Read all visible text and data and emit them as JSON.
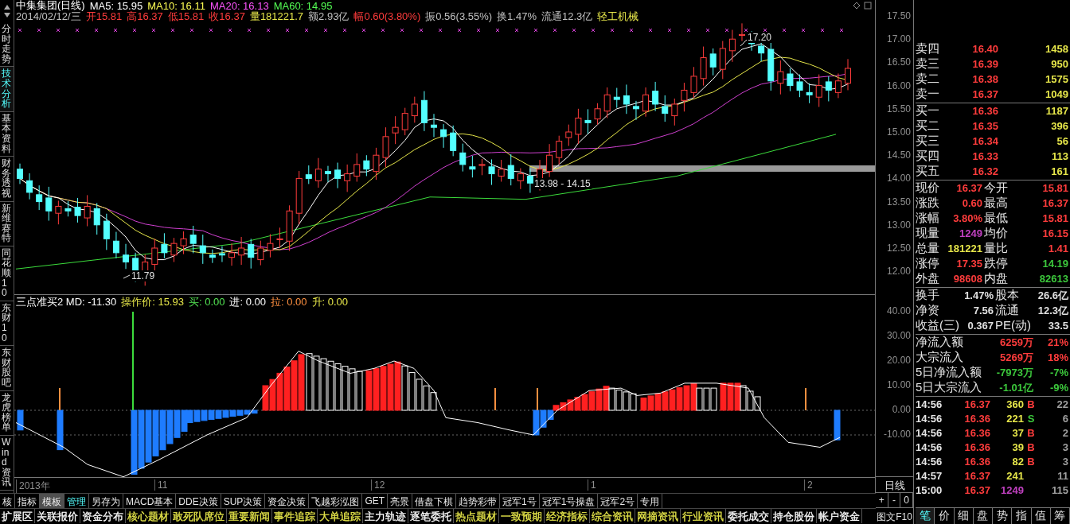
{
  "header": {
    "title_items": [
      {
        "text": "中集集团(日线)",
        "color": "#ffffff"
      },
      {
        "text": "MA5: 15.95",
        "color": "#ffffff"
      },
      {
        "text": "MA10: 16.11",
        "color": "#ffff54"
      },
      {
        "text": "MA20: 16.13",
        "color": "#ff54ff"
      },
      {
        "text": "MA60: 14.95",
        "color": "#54ff54"
      }
    ],
    "quote_items": [
      {
        "text": "2014/02/12/三",
        "color": "#c0c0c0"
      },
      {
        "text": "开15.81",
        "color": "#ff3c3c"
      },
      {
        "text": "高16.37",
        "color": "#ff3c3c"
      },
      {
        "text": "低15.81",
        "color": "#ff3c3c"
      },
      {
        "text": "收16.37",
        "color": "#ff3c3c"
      },
      {
        "text": "量181221.7",
        "color": "#e6e64a"
      },
      {
        "text": "额2.93亿",
        "color": "#c0c0c0"
      },
      {
        "text": "幅0.60(3.80%)",
        "color": "#ff3c3c"
      },
      {
        "text": "振0.56(3.55%)",
        "color": "#c0c0c0"
      },
      {
        "text": "换1.47%",
        "color": "#c0c0c0"
      },
      {
        "text": "流通12.3亿",
        "color": "#c0c0c0"
      },
      {
        "text": "轻工机械",
        "color": "#e6e64a"
      }
    ]
  },
  "left_tabs": [
    {
      "label": "分时走势",
      "selected": false
    },
    {
      "label": "技术分析",
      "selected": true
    },
    {
      "label": "基本资料",
      "selected": false
    },
    {
      "label": "财务透视",
      "selected": false
    },
    {
      "label": "新维赛特",
      "selected": false
    },
    {
      "label": "同花顺10",
      "selected": false
    },
    {
      "label": "东财10",
      "selected": false
    },
    {
      "label": "东财股吧",
      "selected": false
    },
    {
      "label": "龙虎榜单",
      "selected": false
    },
    {
      "label": "Wind资讯",
      "selected": false
    }
  ],
  "price_axis": [
    "17.50",
    "17.00",
    "16.50",
    "16.00",
    "15.50",
    "15.00",
    "14.50",
    "14.00",
    "13.50",
    "13.00",
    "12.50",
    "12.00"
  ],
  "annotations": [
    "17.20",
    "13.98 - 14.15",
    "11.79"
  ],
  "indicator": {
    "items": [
      {
        "text": "三点准买2 MD: -11.30",
        "color": "#ffffff"
      },
      {
        "text": "操作价: 15.93",
        "color": "#e6e64a"
      },
      {
        "text": "买: 0.00",
        "color": "#54e654"
      },
      {
        "text": "进: 0.00",
        "color": "#ffffff"
      },
      {
        "text": "拉: 0.00",
        "color": "#ff9040"
      },
      {
        "text": "升: 0.00",
        "color": "#e6e64a"
      }
    ]
  },
  "indicator_axis": [
    "40.00",
    "30.00",
    "20.00",
    "10.00",
    "0.00",
    "-10.00"
  ],
  "date_axis": [
    "2013年",
    "11",
    "12",
    "1",
    "2"
  ],
  "toolbar": [
    {
      "label": "核",
      "selected": false,
      "pressed": false
    },
    {
      "label": "指标",
      "selected": false,
      "pressed": false
    },
    {
      "label": "模板",
      "selected": false,
      "pressed": true
    },
    {
      "label": "管理",
      "selected": true,
      "pressed": false
    },
    {
      "label": "另存为",
      "selected": false,
      "pressed": false
    },
    {
      "label": "MACD基本",
      "selected": false,
      "pressed": false
    },
    {
      "label": "DDE决策",
      "selected": false,
      "pressed": false
    },
    {
      "label": "SUP决策",
      "selected": false,
      "pressed": false
    },
    {
      "label": "资金决策",
      "selected": false,
      "pressed": false
    },
    {
      "label": "飞越彩泓图",
      "selected": false,
      "pressed": false
    },
    {
      "label": "GET",
      "selected": false,
      "pressed": false
    },
    {
      "label": "亮景",
      "selected": false,
      "pressed": false
    },
    {
      "label": "借盘下棋",
      "selected": false,
      "pressed": false
    },
    {
      "label": "趋势彩带",
      "selected": false,
      "pressed": false
    },
    {
      "label": "冠军1号",
      "selected": false,
      "pressed": false
    },
    {
      "label": "冠军1号操盘",
      "selected": false,
      "pressed": false
    },
    {
      "label": "冠军2号",
      "selected": false,
      "pressed": false
    },
    {
      "label": "专用",
      "selected": false,
      "pressed": false
    }
  ],
  "feature_bar": [
    {
      "label": "扩展区",
      "color": "#ffffff"
    },
    {
      "label": "关联报价",
      "color": "#ffffff"
    },
    {
      "label": "资金分布",
      "color": "#ffffff"
    },
    {
      "label": "核心题材",
      "color": "#e6e64a"
    },
    {
      "label": "敢死队席位",
      "color": "#e6e64a"
    },
    {
      "label": "重要新闻",
      "color": "#e6e64a"
    },
    {
      "label": "事件追踪",
      "color": "#e6e64a"
    },
    {
      "label": "大单追踪",
      "color": "#e6e64a"
    },
    {
      "label": "主力轨迹",
      "color": "#ffffff"
    },
    {
      "label": "逐笔委托",
      "color": "#ffffff"
    },
    {
      "label": "热点题材",
      "color": "#e6e64a"
    },
    {
      "label": "一致预期",
      "color": "#e6e64a"
    },
    {
      "label": "经济指标",
      "color": "#e6e64a"
    },
    {
      "label": "综合资讯",
      "color": "#e6e64a"
    },
    {
      "label": "网摘资讯",
      "color": "#e6e64a"
    },
    {
      "label": "行业资讯",
      "color": "#e6e64a"
    },
    {
      "label": "委托成交",
      "color": "#ffffff"
    },
    {
      "label": "持仓股份",
      "color": "#ffffff"
    },
    {
      "label": "帐户资金",
      "color": "#ffffff"
    }
  ],
  "period": "日线",
  "zoom_buttons": [
    "+",
    "-",
    "0"
  ],
  "f10_button": "图文F10",
  "order_book": {
    "asks": [
      {
        "label": "卖四",
        "price": "16.40",
        "volume": "1458"
      },
      {
        "label": "卖三",
        "price": "16.39",
        "volume": "950"
      },
      {
        "label": "卖二",
        "price": "16.38",
        "volume": "1575"
      },
      {
        "label": "卖一",
        "price": "16.37",
        "volume": "1049"
      }
    ],
    "bids": [
      {
        "label": "买一",
        "price": "16.36",
        "volume": "1187"
      },
      {
        "label": "买二",
        "price": "16.35",
        "volume": "396"
      },
      {
        "label": "买三",
        "price": "16.34",
        "volume": "56"
      },
      {
        "label": "买四",
        "price": "16.33",
        "volume": "113"
      },
      {
        "label": "买五",
        "price": "16.32",
        "volume": "161"
      }
    ]
  },
  "stats": [
    {
      "label": "现价",
      "value": "16.37",
      "color": "#ff3c3c"
    },
    {
      "label": "今开",
      "value": "15.81",
      "color": "#ff3c3c"
    },
    {
      "label": "涨跌",
      "value": "0.60",
      "color": "#ff3c3c"
    },
    {
      "label": "最高",
      "value": "16.37",
      "color": "#ff3c3c"
    },
    {
      "label": "涨幅",
      "value": "3.80%",
      "color": "#ff3c3c"
    },
    {
      "label": "最低",
      "value": "15.81",
      "color": "#ff3c3c"
    },
    {
      "label": "现量",
      "value": "1249",
      "color": "#c040c0"
    },
    {
      "label": "均价",
      "value": "16.15",
      "color": "#ff3c3c"
    },
    {
      "label": "总量",
      "value": "181221",
      "color": "#e6e64a"
    },
    {
      "label": "量比",
      "value": "1.41",
      "color": "#ff3c3c"
    },
    {
      "label": "涨停",
      "value": "17.35",
      "color": "#ff3c3c"
    },
    {
      "label": "跌停",
      "value": "14.19",
      "color": "#3cc83c"
    },
    {
      "label": "外盘",
      "value": "98608",
      "color": "#ff3c3c"
    },
    {
      "label": "内盘",
      "value": "82613",
      "color": "#3cc83c"
    }
  ],
  "fundamentals": [
    {
      "label": "换手",
      "value": "1.47%"
    },
    {
      "label": "股本",
      "value": "26.6亿"
    },
    {
      "label": "净资",
      "value": "7.56"
    },
    {
      "label": "流通",
      "value": "12.3亿"
    },
    {
      "label": "收益(三)",
      "value": "0.367"
    },
    {
      "label": "PE(动)",
      "value": "33.5"
    }
  ],
  "flows": [
    {
      "label": "净流入额",
      "amount": "6259万",
      "percent": "21%",
      "color": "#ff3c3c"
    },
    {
      "label": "大宗流入",
      "amount": "5269万",
      "percent": "18%",
      "color": "#ff3c3c"
    },
    {
      "label": "5日净流入额",
      "amount": "-7973万",
      "percent": "-7%",
      "color": "#3cc83c"
    },
    {
      "label": "5日大宗流入",
      "amount": "-1.01亿",
      "percent": "-9%",
      "color": "#3cc83c"
    }
  ],
  "ticks": [
    {
      "time": "14:56",
      "price": "16.37",
      "volume": {
        "text": "360",
        "color": "#e6e64a"
      },
      "side": {
        "text": "B",
        "color": "#ff3c3c"
      },
      "count": "22"
    },
    {
      "time": "14:56",
      "price": "16.36",
      "volume": {
        "text": "221",
        "color": "#e6e64a"
      },
      "side": {
        "text": "S",
        "color": "#3cc83c"
      },
      "count": "6"
    },
    {
      "time": "14:56",
      "price": "16.36",
      "volume": {
        "text": "37",
        "color": "#e6e64a"
      },
      "side": {
        "text": "B",
        "color": "#ff3c3c"
      },
      "count": "2"
    },
    {
      "time": "14:56",
      "price": "16.36",
      "volume": {
        "text": "39",
        "color": "#e6e64a"
      },
      "side": {
        "text": "B",
        "color": "#ff3c3c"
      },
      "count": "3"
    },
    {
      "time": "14:56",
      "price": "16.36",
      "volume": {
        "text": "82",
        "color": "#e6e64a"
      },
      "side": {
        "text": "B",
        "color": "#ff3c3c"
      },
      "count": "3"
    },
    {
      "time": "14:57",
      "price": "16.37",
      "volume": {
        "text": "241",
        "color": "#e6e64a"
      },
      "count": "11"
    },
    {
      "time": "15:00",
      "price": "16.37",
      "volume": {
        "text": "1249",
        "color": "#c040c0"
      },
      "count": "115"
    }
  ],
  "detail_tabs": [
    {
      "label": "笔",
      "selected": true
    },
    {
      "label": "价",
      "selected": false
    },
    {
      "label": "细",
      "selected": false
    },
    {
      "label": "盘",
      "selected": false
    },
    {
      "label": "势",
      "selected": false
    },
    {
      "label": "指",
      "selected": false
    },
    {
      "label": "值",
      "selected": false
    },
    {
      "label": "筹",
      "selected": false
    }
  ]
}
